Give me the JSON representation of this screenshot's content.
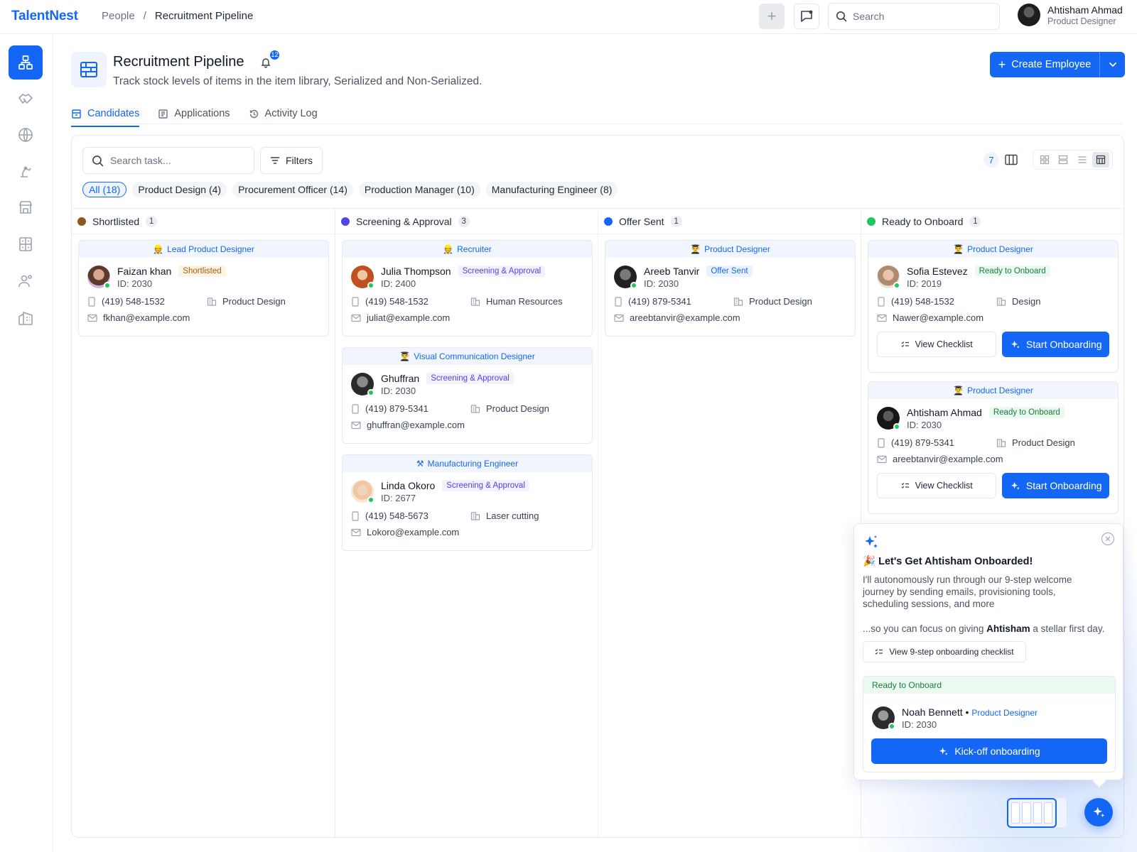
{
  "app": {
    "name": "TalentNest"
  },
  "breadcrumb": {
    "parent": "People",
    "separator": "/",
    "current": "Recruitment Pipeline"
  },
  "topbar": {
    "search_placeholder": "Search"
  },
  "user": {
    "name": "Ahtisham Ahmad",
    "role": "Product Designer"
  },
  "sidebar": {
    "items": [
      {
        "icon": "org-chart-icon",
        "active": true
      },
      {
        "icon": "handshake-icon",
        "active": false
      },
      {
        "icon": "globe-icon",
        "active": false
      },
      {
        "icon": "machine-arm-icon",
        "active": false
      },
      {
        "icon": "store-icon",
        "active": false
      },
      {
        "icon": "calculator-icon",
        "active": false
      },
      {
        "icon": "user-settings-icon",
        "active": false
      },
      {
        "icon": "building-icon",
        "active": false
      }
    ]
  },
  "page": {
    "title": "Recruitment Pipeline",
    "notification_count": "12",
    "subtitle": "Track stock levels of items in the item library, Serialized and Non-Serialized.",
    "create_label": "Create Employee"
  },
  "tabs": [
    {
      "label": "Candidates",
      "active": true
    },
    {
      "label": "Applications",
      "active": false
    },
    {
      "label": "Activity Log",
      "active": false
    }
  ],
  "toolbar": {
    "search_placeholder": "Search task...",
    "filters_label": "Filters",
    "column_count": "7"
  },
  "chips": [
    {
      "label": "All (18)",
      "active": true
    },
    {
      "label": "Product Design (4)",
      "active": false
    },
    {
      "label": "Procurement Officer (14)",
      "active": false
    },
    {
      "label": "Production Manager (10)",
      "active": false
    },
    {
      "label": "Manufacturing Engineer (8)",
      "active": false
    }
  ],
  "columns": [
    {
      "title": "Shortlisted",
      "count": "1",
      "color": "#8a5a1c",
      "cards": [
        {
          "role": "Lead Product Designer",
          "role_emoji": "👷",
          "name": "Faizan khan",
          "status": "Shortlisted",
          "id": "ID: 2030",
          "phone": "(419) 548-1532",
          "dept": "Product Design",
          "email": "fkhan@example.com"
        }
      ]
    },
    {
      "title": "Screening & Approval",
      "count": "3",
      "color": "#4f46e5",
      "cards": [
        {
          "role": "Recruiter",
          "role_emoji": "👷",
          "name": "Julia Thompson",
          "status": "Screening & Approval",
          "id": "ID: 2400",
          "phone": "(419) 548-1532",
          "dept": "Human Resources",
          "email": "juliat@example.com"
        },
        {
          "role": "Visual Communication Designer",
          "role_emoji": "👨‍🎓",
          "name": "Ghuffran",
          "status": "Screening & Approval",
          "id": "ID: 2030",
          "phone": "(419) 879-5341",
          "dept": "Product Design",
          "email": "ghuffran@example.com"
        },
        {
          "role": "Manufacturing Engineer",
          "role_emoji": "⚒",
          "name": "Linda Okoro",
          "status": "Screening & Approval",
          "id": "ID: 2677",
          "phone": "(419) 548-5673",
          "dept": "Laser cutting",
          "email": "Lokoro@example.com"
        }
      ]
    },
    {
      "title": "Offer Sent",
      "count": "1",
      "color": "#1467f5",
      "cards": [
        {
          "role": "Product Designer",
          "role_emoji": "👨‍🎓",
          "name": "Areeb Tanvir",
          "status": "Offer Sent",
          "id": "ID: 2030",
          "phone": "(419) 879-5341",
          "dept": "Product Design",
          "email": "areebtanvir@example.com"
        }
      ]
    },
    {
      "title": "Ready to Onboard",
      "count": "1",
      "color": "#22c55e",
      "cards": [
        {
          "role": "Product Designer",
          "role_emoji": "👨‍🎓",
          "name": "Sofia Estevez",
          "status": "Ready to Onboard",
          "id": "ID: 2019",
          "phone": "(419) 548-1532",
          "dept": "Design",
          "email": "Nawer@example.com",
          "checklist_label": "View Checklist",
          "onboard_label": "Start Onboarding"
        },
        {
          "role": "Product Designer",
          "role_emoji": "👨‍🎓",
          "name": "Ahtisham Ahmad",
          "status": "Ready to Onboard",
          "id": "ID: 2030",
          "phone": "(419) 879-5341",
          "dept": "Product Design",
          "email": "areebtanvir@example.com",
          "checklist_label": "View Checklist",
          "onboard_label": "Start Onboarding"
        }
      ]
    }
  ],
  "ai_popover": {
    "title": "Let's Get Ahtisham Onboarded!",
    "title_emoji": "🎉",
    "description": "I'll autonomously run through our 9-step welcome journey by sending emails, provisioning tools, scheduling sessions, and more",
    "focus_prefix": "...so you can focus on giving ",
    "focus_name": "Ahtisham",
    "focus_suffix": " a stellar first day.",
    "checklist_label": "View 9-step onboarding checklist",
    "card_status": "Ready to Onboard",
    "card_name": "Noah Bennett",
    "card_separator": "•",
    "card_role": "Product Designer",
    "card_id": "ID: 2030",
    "kickoff_label": "Kick-off onboarding"
  },
  "colors": {
    "accent": "#1467f5",
    "success": "#22c55e",
    "screening": "#4f46e5",
    "shortlist": "#8a5a1c"
  }
}
